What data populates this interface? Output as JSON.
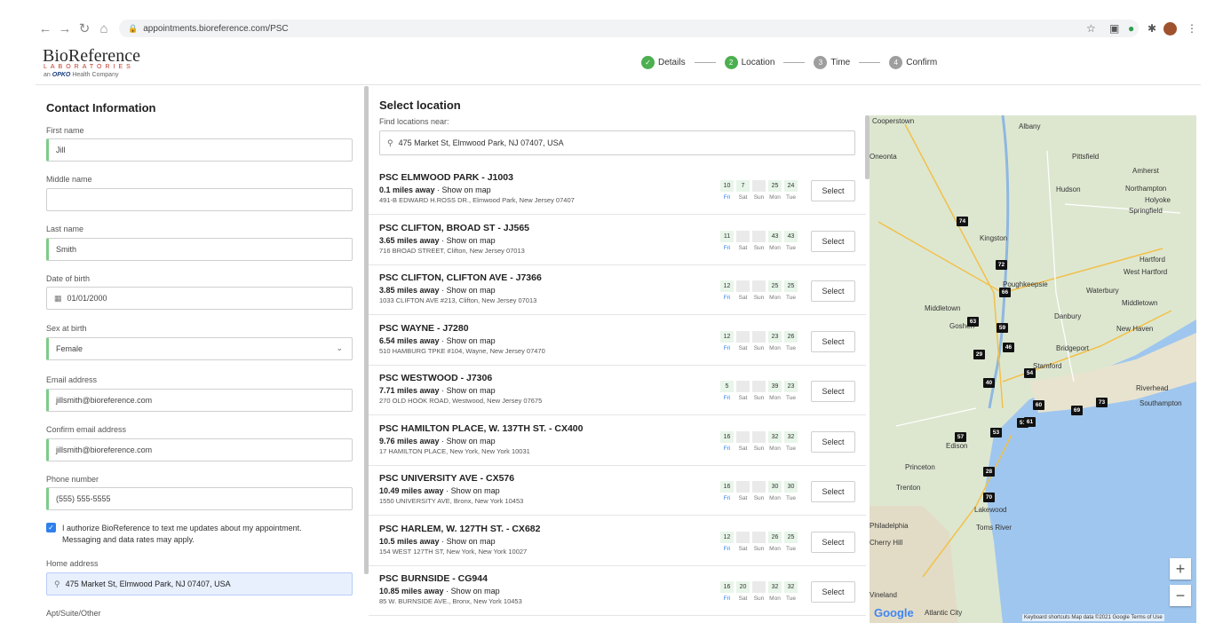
{
  "browser": {
    "url": "appointments.bioreference.com/PSC"
  },
  "brand": {
    "name": "BioReference",
    "sub": "LABORATORIES",
    "tagline_prefix": "an",
    "tagline_company": "OPKO",
    "tagline_suffix": "Health Company",
    "accent": "#4caf50"
  },
  "steps": [
    {
      "num": "✓",
      "label": "Details",
      "state": "done"
    },
    {
      "num": "2",
      "label": "Location",
      "state": "active"
    },
    {
      "num": "3",
      "label": "Time",
      "state": "todo"
    },
    {
      "num": "4",
      "label": "Confirm",
      "state": "todo"
    }
  ],
  "contact": {
    "title": "Contact Information",
    "first_name_label": "First name",
    "first_name": "Jill",
    "middle_name_label": "Middle name",
    "middle_name": "",
    "last_name_label": "Last name",
    "last_name": "Smith",
    "dob_label": "Date of birth",
    "dob": "01/01/2000",
    "sex_label": "Sex at birth",
    "sex": "Female",
    "email_label": "Email address",
    "email": "jillsmith@bioreference.com",
    "confirm_email_label": "Confirm email address",
    "confirm_email": "jillsmith@bioreference.com",
    "phone_label": "Phone number",
    "phone": "(555) 555-5555",
    "consent_line1": "I authorize BioReference to text me updates about my appointment.",
    "consent_line2": "Messaging and data rates may apply.",
    "home_address_label": "Home address",
    "home_address": "475 Market St, Elmwood Park, NJ 07407, USA",
    "apt_label": "Apt/Suite/Other"
  },
  "locations_panel": {
    "title": "Select location",
    "find_label": "Find locations near:",
    "search_value": "475 Market St, Elmwood Park, NJ 07407, USA",
    "show_on_map": "Show on map",
    "select_label": "Select",
    "day_names": [
      "Fri",
      "Sat",
      "Sun",
      "Mon",
      "Tue"
    ]
  },
  "locations": [
    {
      "name": "PSC ELMWOOD PARK - J1003",
      "distance": "0.1 miles away",
      "address": "491-B EDWARD H.ROSS DR., Elmwood Park, New Jersey 07407",
      "slots": [
        "10",
        "7",
        "",
        "25",
        "24"
      ]
    },
    {
      "name": "PSC CLIFTON, BROAD ST - JJ565",
      "distance": "3.65 miles away",
      "address": "716 BROAD STREET, Clifton, New Jersey 07013",
      "slots": [
        "11",
        "",
        "",
        "43",
        "43"
      ]
    },
    {
      "name": "PSC CLIFTON, CLIFTON AVE - J7366",
      "distance": "3.85 miles away",
      "address": "1033 CLIFTON AVE #213, Clifton, New Jersey 07013",
      "slots": [
        "12",
        "",
        "",
        "25",
        "25"
      ]
    },
    {
      "name": "PSC WAYNE - J7280",
      "distance": "6.54 miles away",
      "address": "510 HAMBURG TPKE #104, Wayne, New Jersey 07470",
      "slots": [
        "12",
        "",
        "",
        "23",
        "26"
      ]
    },
    {
      "name": "PSC WESTWOOD - J7306",
      "distance": "7.71 miles away",
      "address": "270 OLD HOOK ROAD, Westwood, New Jersey 07675",
      "slots": [
        "5",
        "",
        "",
        "39",
        "23"
      ]
    },
    {
      "name": "PSC HAMILTON PLACE, W. 137TH ST. - CX400",
      "distance": "9.76 miles away",
      "address": "17 HAMILTON PLACE, New York, New York 10031",
      "slots": [
        "16",
        "",
        "",
        "32",
        "32"
      ]
    },
    {
      "name": "PSC UNIVERSITY AVE - CX576",
      "distance": "10.49 miles away",
      "address": "1550 UNIVERSITY AVE, Bronx, New York 10453",
      "slots": [
        "16",
        "",
        "",
        "30",
        "30"
      ]
    },
    {
      "name": "PSC HARLEM, W. 127TH ST. - CX682",
      "distance": "10.5 miles away",
      "address": "154 WEST 127TH ST, New York, New York 10027",
      "slots": [
        "12",
        "",
        "",
        "26",
        "25"
      ]
    },
    {
      "name": "PSC BURNSIDE - CG944",
      "distance": "10.85 miles away",
      "address": "85 W. BURNSIDE AVE., Bronx, New York 10453",
      "slots": [
        "16",
        "20",
        "",
        "32",
        "32"
      ]
    }
  ],
  "map": {
    "places": [
      "Cooperstown",
      "Albany",
      "Oneonta",
      "Pittsfield",
      "Amherst",
      "Hudson",
      "Northampton",
      "Holyoke",
      "Springfield",
      "Kingston",
      "Hartford",
      "West Hartford",
      "Poughkeepsie",
      "Waterbury",
      "Middletown",
      "Middletown",
      "Danbury",
      "New Haven",
      "Goshen",
      "Bridgeport",
      "Stamford",
      "Riverhead",
      "Southampton",
      "Edison",
      "Princeton",
      "Trenton",
      "Lakewood",
      "Toms River",
      "Philadelphia",
      "Cherry Hill",
      "Vineland",
      "Atlantic City"
    ],
    "pins": [
      "74",
      "72",
      "66",
      "63",
      "59",
      "46",
      "29",
      "54",
      "40",
      "60",
      "51",
      "57",
      "53",
      "61",
      "69",
      "73",
      "70",
      "28"
    ],
    "zoom_in": "+",
    "zoom_out": "−",
    "logo": "Google",
    "attribution": "Keyboard shortcuts   Map data ©2021 Google   Terms of Use"
  }
}
